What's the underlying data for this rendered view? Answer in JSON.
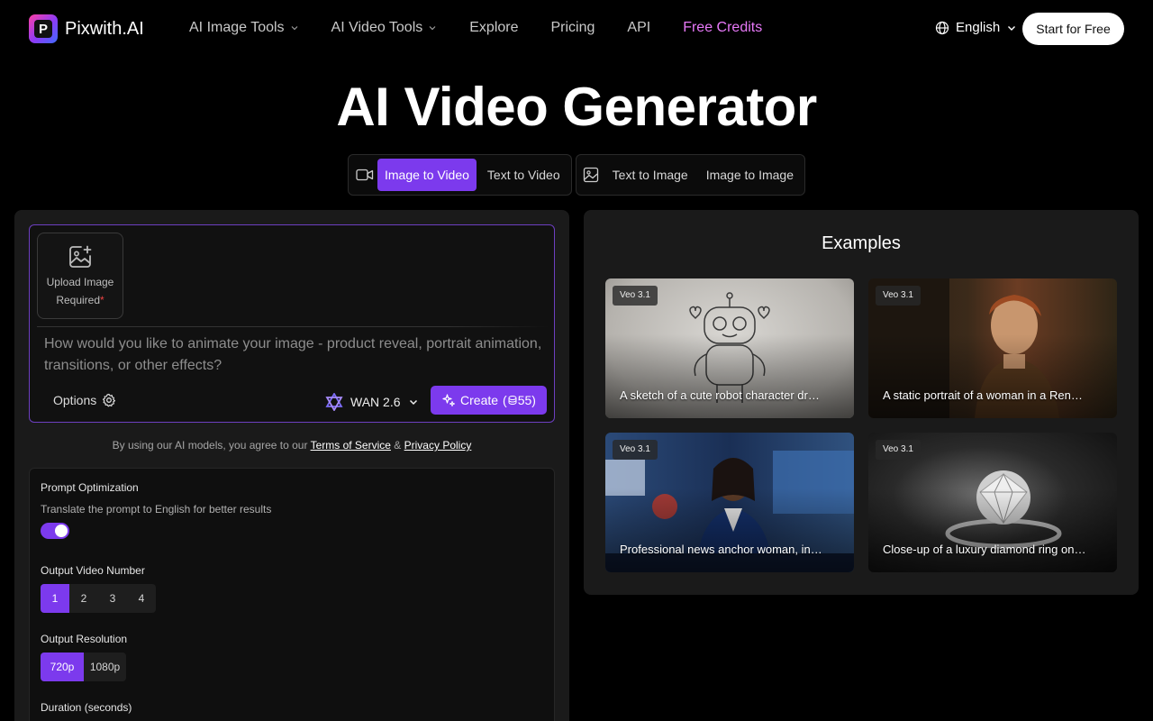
{
  "nav": {
    "brand": "Pixwith.AI",
    "menu": [
      {
        "label": "AI Image Tools",
        "dropdown": true
      },
      {
        "label": "AI Video Tools",
        "dropdown": true
      },
      {
        "label": "Explore"
      },
      {
        "label": "Pricing"
      },
      {
        "label": "API"
      },
      {
        "label": "Free Credits",
        "color": "#e879f9"
      }
    ],
    "language": "English",
    "cta": "Start for Free"
  },
  "hero": {
    "title": "AI Video Generator"
  },
  "modes": {
    "video_group": [
      "Image to Video",
      "Text to Video"
    ],
    "image_group": [
      "Text to Image",
      "Image to Image"
    ],
    "active": "Image to Video"
  },
  "generator": {
    "upload_label": "Upload Image",
    "upload_required": "Required",
    "required_mark": "*",
    "prompt_placeholder": "How would you like to animate your image - product reveal, portrait animation, transitions, or other effects?",
    "options_label": "Options",
    "model": "WAN 2.6",
    "create_label": "Create",
    "create_cost": "55",
    "terms_prefix": "By using our AI models, you agree to our",
    "terms_link": "Terms of Service",
    "terms_and": "&",
    "privacy_link": "Privacy Policy"
  },
  "settings": {
    "prompt_opt_label": "Prompt Optimization",
    "prompt_opt_desc": "Translate the prompt to English for better results",
    "prompt_opt_enabled": true,
    "video_number_label": "Output Video Number",
    "video_numbers": [
      "1",
      "2",
      "3",
      "4"
    ],
    "video_number_selected": "1",
    "resolution_label": "Output Resolution",
    "resolutions": [
      "720p",
      "1080p"
    ],
    "resolution_selected": "720p",
    "duration_label": "Duration (seconds)"
  },
  "examples": {
    "title": "Examples",
    "items": [
      {
        "badge": "Veo 3.1",
        "caption": "A sketch of a cute robot character drawing on paper"
      },
      {
        "badge": "Veo 3.1",
        "caption": "A static portrait of a woman in a Renaissance painting"
      },
      {
        "badge": "Veo 3.1",
        "caption": "Professional news anchor woman, in a studio"
      },
      {
        "badge": "Veo 3.1",
        "caption": "Close-up of a luxury diamond ring on black velvet"
      }
    ]
  },
  "colors": {
    "accent": "#7c3aed",
    "highlight": "#e879f9",
    "panel": "#1a1a1a"
  }
}
